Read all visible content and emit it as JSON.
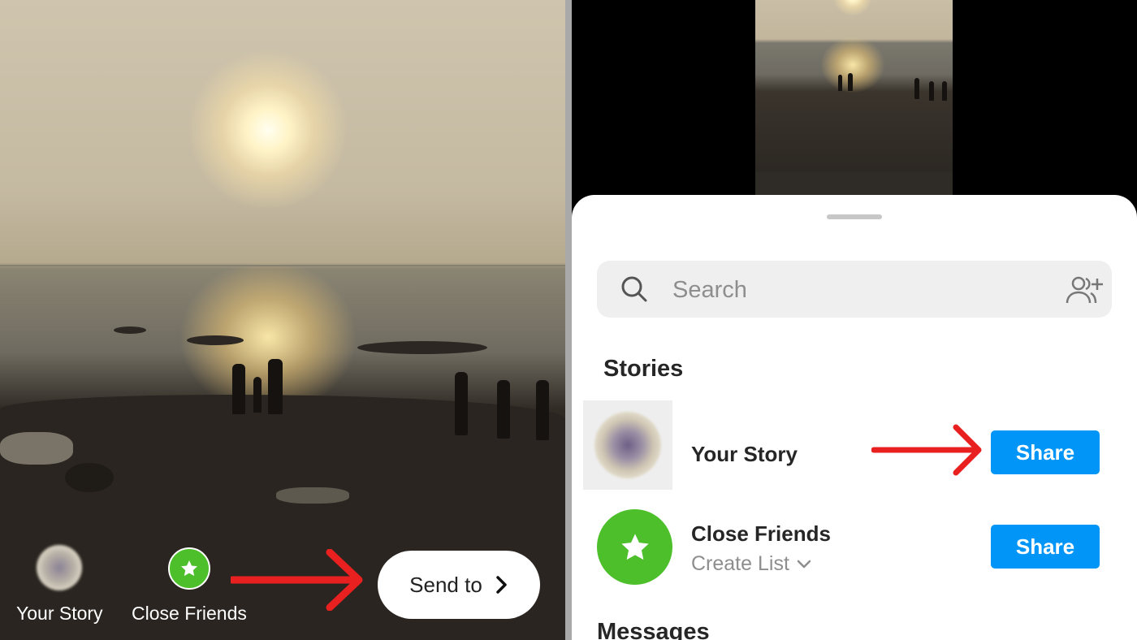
{
  "left_panel": {
    "your_story_label": "Your Story",
    "close_friends_label": "Close Friends",
    "send_to_label": "Send to"
  },
  "share_sheet": {
    "search": {
      "placeholder": "Search"
    },
    "stories_heading": "Stories",
    "rows": [
      {
        "name": "Your Story",
        "button": "Share"
      },
      {
        "name": "Close Friends",
        "subtitle": "Create List",
        "button": "Share"
      }
    ],
    "messages_heading": "Messages"
  },
  "colors": {
    "share_blue": "#0095f6",
    "close_friends_green": "#4cbf2b",
    "annotation_red": "#e8201f"
  },
  "icons": [
    "search-icon",
    "add-people-icon",
    "star-icon",
    "chevron-right-icon",
    "chevron-down-icon"
  ]
}
